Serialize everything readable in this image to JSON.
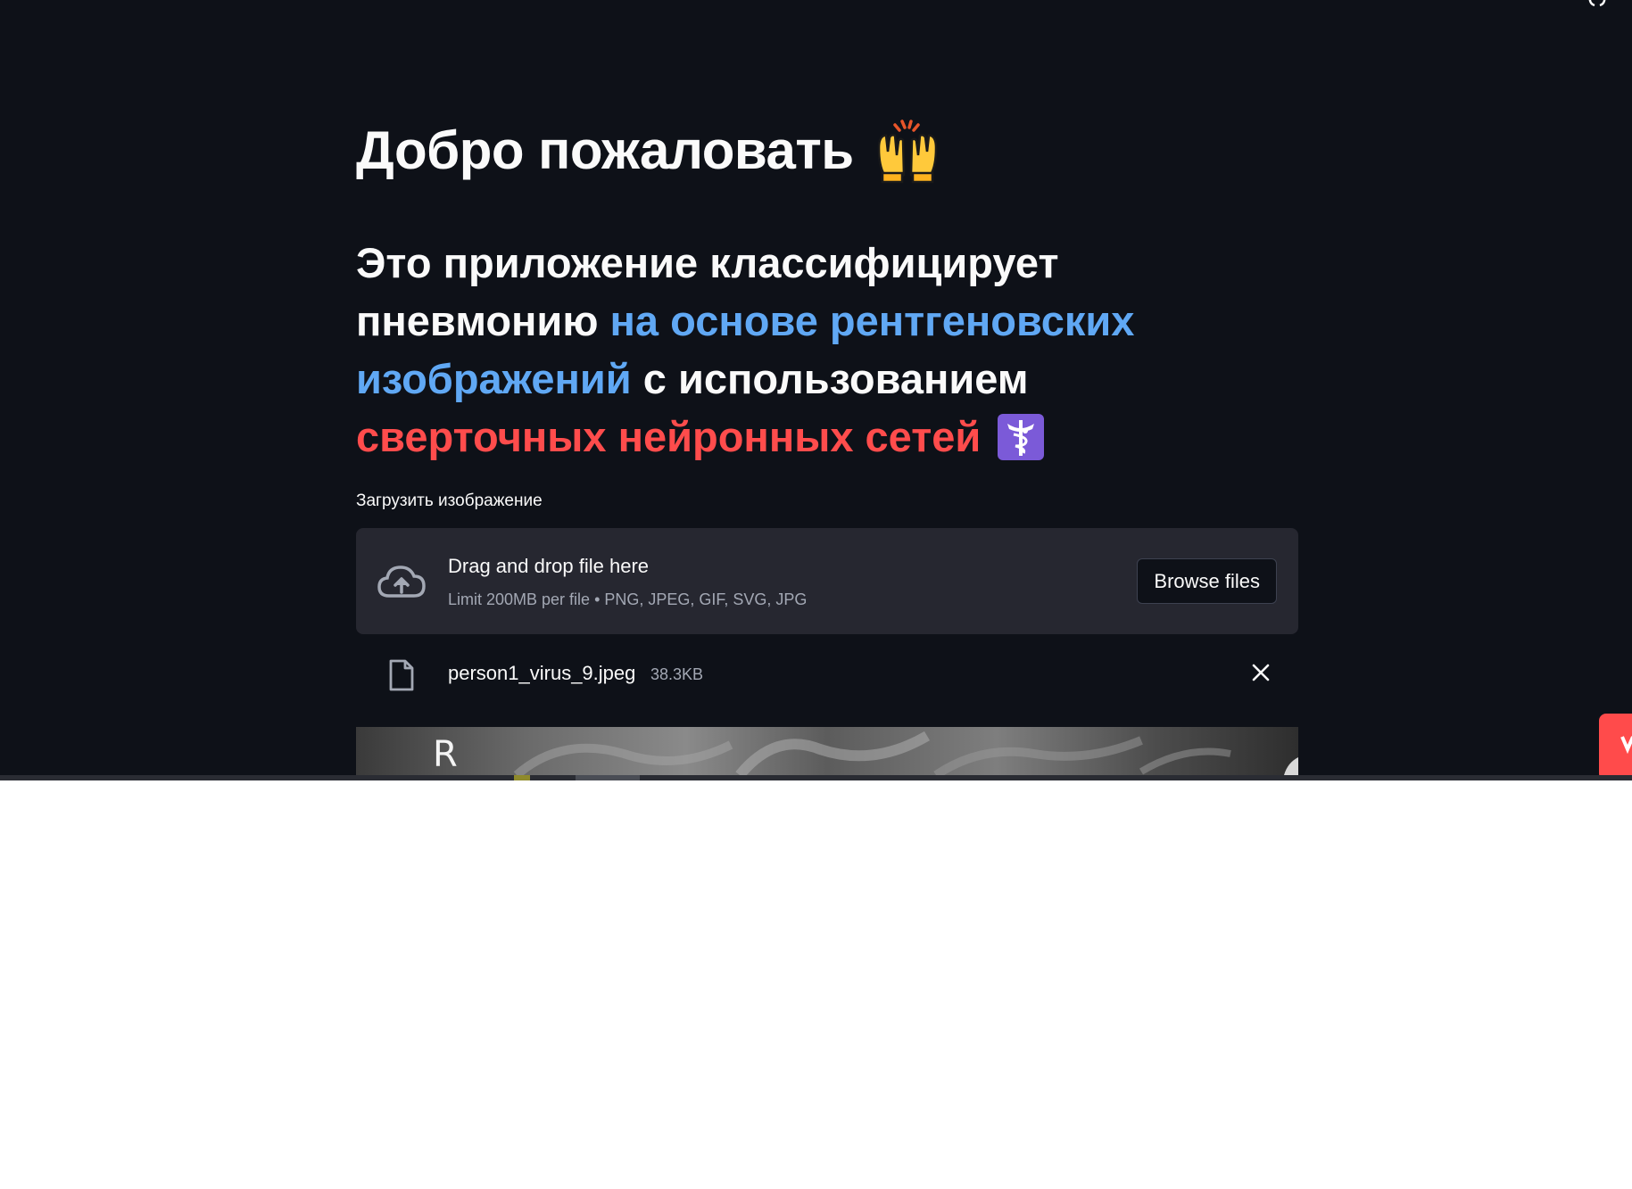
{
  "page": {
    "title": "Добро пожаловать",
    "title_emoji": "raising-hands-emoji",
    "subtitle": {
      "part1": "Это приложение классифицирует пневмонию ",
      "highlight_blue": "на основе рентгеновских изображений",
      "part2": " с использованием ",
      "highlight_red": "сверточных нейронных сетей",
      "end_emoji": "medical-symbol-emoji"
    }
  },
  "uploader": {
    "label": "Загрузить изображение",
    "drop_title": "Drag and drop file here",
    "drop_hint": "Limit 200MB per file • PNG, JPEG, GIF, SVG, JPG",
    "browse_label": "Browse files",
    "icon": "cloud-upload-icon"
  },
  "uploaded_file": {
    "name": "person1_virus_9.jpeg",
    "size": "38.3KB",
    "icon": "file-icon",
    "remove_icon": "close-icon"
  },
  "preview": {
    "marker": "R"
  },
  "colors": {
    "background": "#0e1118",
    "text": "#fafafa",
    "blue_highlight": "#60a8f4",
    "red_highlight": "#ff4c4c",
    "dropzone": "#262730",
    "muted": "#a3a8b4",
    "accent": "#ff4b4b"
  }
}
